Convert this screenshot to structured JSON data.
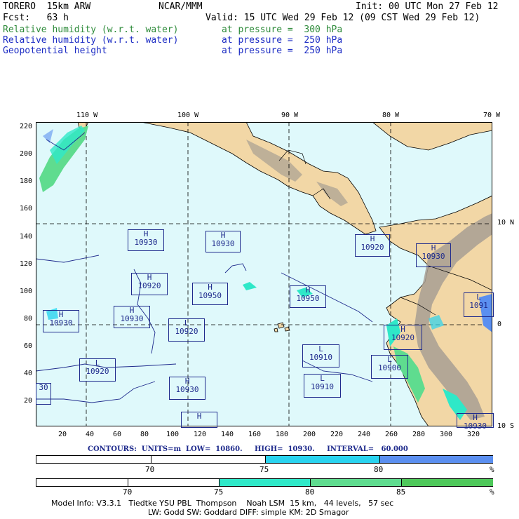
{
  "header": {
    "model": "TORERO  15km ARW",
    "org": "NCAR/MMM",
    "init": "Init: 00 UTC Mon 27 Feb 12",
    "fcst": "Fcst:   63 h",
    "valid": "Valid: 15 UTC Wed 29 Feb 12 (09 CST Wed 29 Feb 12)",
    "fields": [
      {
        "name": "Relative humidity (w.r.t. water)",
        "level": "at pressure =  300 hPa",
        "color": "#2e8b3a"
      },
      {
        "name": "Relative humidity (w.r.t. water)",
        "level": "at pressure =  250 hPa",
        "color": "#1c2cc4"
      },
      {
        "name": "Geopotential height",
        "level": "at pressure =  250 hPa",
        "color": "#1c2cc4"
      }
    ]
  },
  "map": {
    "ocean_color": "#dff9fb",
    "land_color": "#f2d7a6",
    "terrain_color": "#a89f93",
    "lon_labels": [
      "110 W",
      "100 W",
      "90 W",
      "80 W",
      "70 W"
    ],
    "lat_labels": [
      "10 N",
      "0",
      "10 S"
    ],
    "y_ticks": [
      "220",
      "200",
      "180",
      "160",
      "140",
      "120",
      "100",
      "80",
      "60",
      "40",
      "20"
    ],
    "x_ticks": [
      "20",
      "40",
      "60",
      "80",
      "100",
      "120",
      "140",
      "160",
      "180",
      "200",
      "220",
      "240",
      "260",
      "280",
      "300",
      "320"
    ],
    "centers": [
      {
        "type": "H",
        "value": "10930"
      },
      {
        "type": "H",
        "value": "10930"
      },
      {
        "type": "H",
        "value": "10920"
      },
      {
        "type": "H",
        "value": "10950"
      },
      {
        "type": "H",
        "value": "10950"
      },
      {
        "type": "H",
        "value": "10930"
      },
      {
        "type": "H",
        "value": "10930"
      },
      {
        "type": "L",
        "value": "10920"
      },
      {
        "type": "L",
        "value": "10920"
      },
      {
        "type": "H",
        "value": "10920"
      },
      {
        "type": "H",
        "value": "10930"
      },
      {
        "type": "L",
        "value": "10910"
      },
      {
        "type": "L",
        "value": "10910"
      },
      {
        "type": "L",
        "value": "10900"
      },
      {
        "type": "H",
        "value": "10920"
      },
      {
        "type": "L",
        "value": "1091"
      },
      {
        "type": "H",
        "value": "10930"
      },
      {
        "type": "H",
        "value": "10930"
      },
      {
        "type": "H",
        "value": ""
      },
      {
        "type": "",
        "value": "30"
      }
    ]
  },
  "contours": {
    "label": "CONTOURS:  UNITS=m  LOW=  10860.     HIGH=  10930.     INTERVAL=   60.000"
  },
  "scale_250": {
    "labels": [
      "70",
      "75",
      "80"
    ],
    "unit": "%",
    "colors": [
      "#ffffff",
      "#ffffff",
      "#29d3ef",
      "#5b8ff0"
    ]
  },
  "scale_300": {
    "labels": [
      "70",
      "75",
      "80",
      "85"
    ],
    "unit": "%",
    "colors": [
      "#ffffff",
      "#ffffff",
      "#2fe8c8",
      "#5fdc8f",
      "#4ec85a"
    ]
  },
  "footer": {
    "line1": "Model Info: V3.3.1   Tiedtke YSU PBL  Thompson    Noah LSM  15 km,   44 levels,   57 sec",
    "line2": "LW: Godd SW: Goddard DIFF: simple KM: 2D Smagor"
  }
}
